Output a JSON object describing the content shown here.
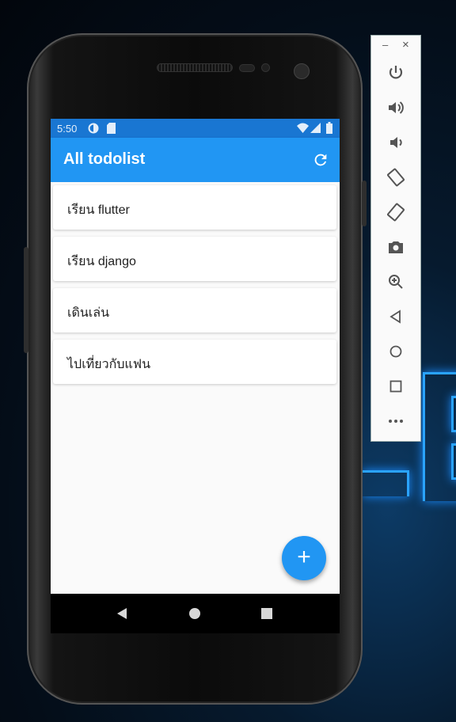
{
  "status_bar": {
    "time": "5:50"
  },
  "app_bar": {
    "title": "All todolist",
    "refresh_icon": "refresh-icon"
  },
  "todos": [
    {
      "label": "เรียน flutter"
    },
    {
      "label": "เรียน django"
    },
    {
      "label": "เดินเล่น"
    },
    {
      "label": "ไปเที่ยวกับแฟน"
    }
  ],
  "fab": {
    "label": "+"
  },
  "emulator_panel": {
    "minimize": "–",
    "close": "×",
    "buttons": [
      "power-icon",
      "volume-up-icon",
      "volume-down-icon",
      "rotate-left-icon",
      "rotate-right-icon",
      "camera-icon",
      "zoom-icon",
      "back-icon",
      "home-icon",
      "overview-icon",
      "more-icon"
    ]
  },
  "colors": {
    "primary": "#2196f3",
    "status": "#1976d2",
    "background": "#fafafa"
  }
}
